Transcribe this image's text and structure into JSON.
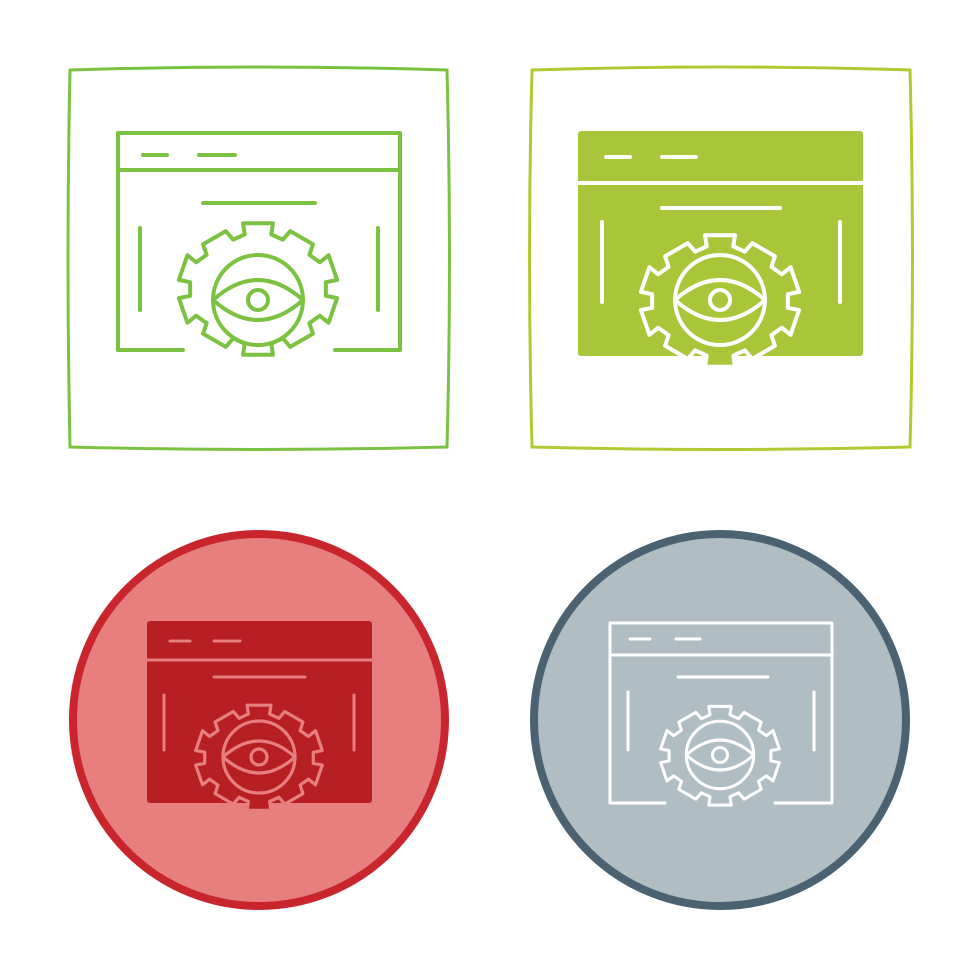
{
  "icons": [
    {
      "name": "icon-variant-line-green",
      "style": "outline",
      "frame": "square",
      "frame_color": "#7cc242",
      "frame_fill": "#ffffff",
      "window_fill": "none",
      "stroke": "#7cc242"
    },
    {
      "name": "icon-variant-filled-lime",
      "style": "glyph",
      "frame": "square",
      "frame_color": "#b3c934",
      "frame_fill": "#ffffff",
      "window_fill": "#a9c63a",
      "stroke": "#ffffff"
    },
    {
      "name": "icon-variant-filled-red",
      "style": "glyph",
      "frame": "circle",
      "frame_color": "#c8262c",
      "frame_fill": "#e77e80",
      "window_fill": "#b81f25",
      "stroke": "#e77e80"
    },
    {
      "name": "icon-variant-line-slate",
      "style": "outline",
      "frame": "circle",
      "frame_color": "#4a6272",
      "frame_fill": "#b0bec3",
      "window_fill": "none",
      "stroke": "#ffffff"
    }
  ]
}
